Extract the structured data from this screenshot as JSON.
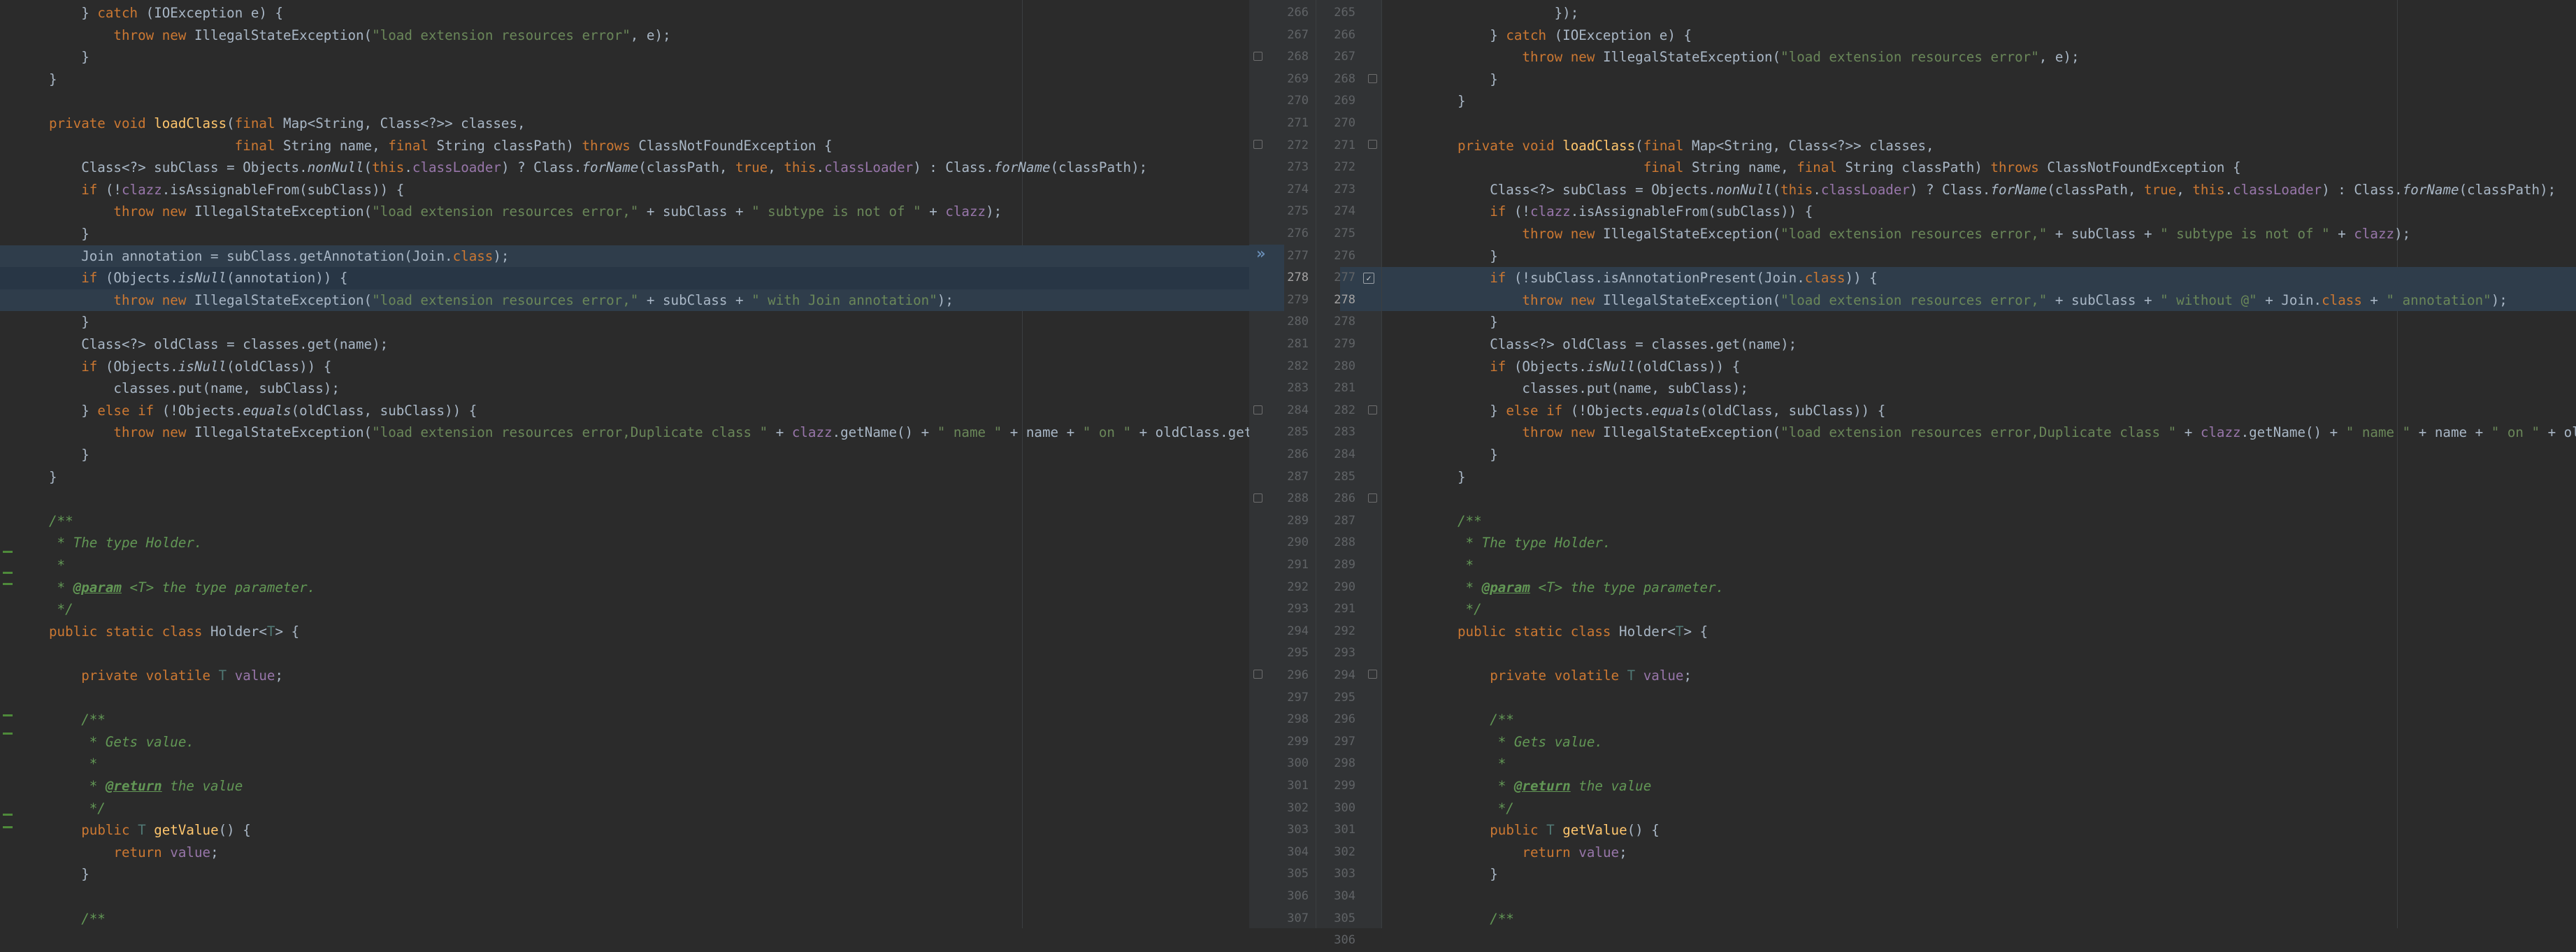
{
  "left": {
    "lines": [
      [
        [
          "    ",
          "n"
        ],
        [
          "} ",
          "n"
        ],
        [
          "catch ",
          "k"
        ],
        [
          "(IOException e) {",
          "n"
        ]
      ],
      [
        [
          "        ",
          "n"
        ],
        [
          "throw new ",
          "k"
        ],
        [
          "IllegalStateException(",
          "n"
        ],
        [
          "\"load extension resources error\"",
          "s"
        ],
        [
          ", e);",
          "n"
        ]
      ],
      [
        [
          "    }",
          "n"
        ]
      ],
      [
        [
          "}",
          "n"
        ]
      ],
      [
        [
          "",
          "n"
        ]
      ],
      [
        [
          "private void ",
          "k"
        ],
        [
          "loadClass",
          "f"
        ],
        [
          "(",
          "n"
        ],
        [
          "final ",
          "k"
        ],
        [
          "Map<String, Class<?>> classes,",
          "n"
        ]
      ],
      [
        [
          "                       ",
          "n"
        ],
        [
          "final ",
          "k"
        ],
        [
          "String name, ",
          "n"
        ],
        [
          "final ",
          "k"
        ],
        [
          "String classPath) ",
          "n"
        ],
        [
          "throws ",
          "k"
        ],
        [
          "ClassNotFoundException {",
          "n"
        ]
      ],
      [
        [
          "    Class<?> subClass = Objects.",
          "n"
        ],
        [
          "nonNull",
          "i"
        ],
        [
          "(",
          "n"
        ],
        [
          "this",
          "k"
        ],
        [
          ".",
          "n"
        ],
        [
          "classLoader",
          "p"
        ],
        [
          ") ? Class.",
          "n"
        ],
        [
          "forName",
          "i"
        ],
        [
          "(classPath, ",
          "n"
        ],
        [
          "true",
          "k"
        ],
        [
          ", ",
          "n"
        ],
        [
          "this",
          "k"
        ],
        [
          ".",
          "n"
        ],
        [
          "classLoader",
          "p"
        ],
        [
          ") : Class.",
          "n"
        ],
        [
          "forName",
          "i"
        ],
        [
          "(classPath);",
          "n"
        ]
      ],
      [
        [
          "    ",
          "n"
        ],
        [
          "if ",
          "k"
        ],
        [
          "(!",
          "n"
        ],
        [
          "clazz",
          "p"
        ],
        [
          ".isAssignableFrom(subClass)) {",
          "n"
        ]
      ],
      [
        [
          "        ",
          "n"
        ],
        [
          "throw new ",
          "k"
        ],
        [
          "IllegalStateException(",
          "n"
        ],
        [
          "\"load extension resources error,\"",
          "s"
        ],
        [
          " + subClass + ",
          "n"
        ],
        [
          "\" subtype is not of \"",
          "s"
        ],
        [
          " + ",
          "n"
        ],
        [
          "clazz",
          "p"
        ],
        [
          ");",
          "n"
        ]
      ],
      [
        [
          "    }",
          "n"
        ]
      ],
      [
        [
          "    Join annotation = subClass.getAnnotation(Join.",
          "n"
        ],
        [
          "class",
          "k"
        ],
        [
          ");",
          "n"
        ]
      ],
      [
        [
          "    ",
          "n"
        ],
        [
          "if ",
          "k"
        ],
        [
          "(Objects.",
          "n"
        ],
        [
          "isNull",
          "i"
        ],
        [
          "(annotation)) {",
          "n"
        ]
      ],
      [
        [
          "        ",
          "n"
        ],
        [
          "throw new ",
          "k"
        ],
        [
          "IllegalStateException(",
          "n"
        ],
        [
          "\"load extension resources error,\"",
          "s"
        ],
        [
          " + subClass + ",
          "n"
        ],
        [
          "\" with Join annotation\"",
          "s"
        ],
        [
          ");",
          "n"
        ]
      ],
      [
        [
          "    }",
          "n"
        ]
      ],
      [
        [
          "    Class<?> oldClass = classes.get(name);",
          "n"
        ]
      ],
      [
        [
          "    ",
          "n"
        ],
        [
          "if ",
          "k"
        ],
        [
          "(Objects.",
          "n"
        ],
        [
          "isNull",
          "i"
        ],
        [
          "(oldClass)) {",
          "n"
        ]
      ],
      [
        [
          "        classes.put(name, subClass);",
          "n"
        ]
      ],
      [
        [
          "    } ",
          "n"
        ],
        [
          "else if ",
          "k"
        ],
        [
          "(!Objects.",
          "n"
        ],
        [
          "equals",
          "i"
        ],
        [
          "(oldClass, subClass)) {",
          "n"
        ]
      ],
      [
        [
          "        ",
          "n"
        ],
        [
          "throw new ",
          "k"
        ],
        [
          "IllegalStateException(",
          "n"
        ],
        [
          "\"load extension resources error,Duplicate class \"",
          "s"
        ],
        [
          " + ",
          "n"
        ],
        [
          "clazz",
          "p"
        ],
        [
          ".getName() + ",
          "n"
        ],
        [
          "\" name \"",
          "s"
        ],
        [
          " + name + ",
          "n"
        ],
        [
          "\" on \"",
          "s"
        ],
        [
          " + oldClass.getName() + ",
          "n"
        ]
      ],
      [
        [
          "    }",
          "n"
        ]
      ],
      [
        [
          "}",
          "n"
        ]
      ],
      [
        [
          "",
          "n"
        ]
      ],
      [
        [
          "/**",
          "c"
        ]
      ],
      [
        [
          " * The type Holder.",
          "c"
        ]
      ],
      [
        [
          " *",
          "c"
        ]
      ],
      [
        [
          " * ",
          "c"
        ],
        [
          "@param",
          "d"
        ],
        [
          " <T> the type parameter.",
          "c"
        ]
      ],
      [
        [
          " */",
          "c"
        ]
      ],
      [
        [
          "public static class ",
          "k"
        ],
        [
          "Holder<",
          "n"
        ],
        [
          "T",
          "t"
        ],
        [
          "> {",
          "n"
        ]
      ],
      [
        [
          "",
          "n"
        ]
      ],
      [
        [
          "    ",
          "n"
        ],
        [
          "private volatile ",
          "k"
        ],
        [
          "T ",
          "t"
        ],
        [
          "value",
          "p"
        ],
        [
          ";",
          "n"
        ]
      ],
      [
        [
          "",
          "n"
        ]
      ],
      [
        [
          "    /**",
          "c"
        ]
      ],
      [
        [
          "     * Gets value.",
          "c"
        ]
      ],
      [
        [
          "     *",
          "c"
        ]
      ],
      [
        [
          "     * ",
          "c"
        ],
        [
          "@return",
          "d"
        ],
        [
          " the value",
          "c"
        ]
      ],
      [
        [
          "     */",
          "c"
        ]
      ],
      [
        [
          "    ",
          "n"
        ],
        [
          "public ",
          "k"
        ],
        [
          "T ",
          "t"
        ],
        [
          "getValue",
          "f"
        ],
        [
          "() {",
          "n"
        ]
      ],
      [
        [
          "        ",
          "n"
        ],
        [
          "return ",
          "k"
        ],
        [
          "value",
          "p"
        ],
        [
          ";",
          "n"
        ]
      ],
      [
        [
          "    }",
          "n"
        ]
      ],
      [
        [
          "",
          "n"
        ]
      ],
      [
        [
          "    /**",
          "c"
        ]
      ]
    ]
  },
  "right": {
    "lines": [
      [
        [
          "            });",
          "n"
        ]
      ],
      [
        [
          "    } ",
          "n"
        ],
        [
          "catch ",
          "k"
        ],
        [
          "(IOException e) {",
          "n"
        ]
      ],
      [
        [
          "        ",
          "n"
        ],
        [
          "throw new ",
          "k"
        ],
        [
          "IllegalStateException(",
          "n"
        ],
        [
          "\"load extension resources error\"",
          "s"
        ],
        [
          ", e);",
          "n"
        ]
      ],
      [
        [
          "    }",
          "n"
        ]
      ],
      [
        [
          "}",
          "n"
        ]
      ],
      [
        [
          "",
          "n"
        ]
      ],
      [
        [
          "private void ",
          "k"
        ],
        [
          "loadClass",
          "f"
        ],
        [
          "(",
          "n"
        ],
        [
          "final ",
          "k"
        ],
        [
          "Map<String, Class<?>> classes,",
          "n"
        ]
      ],
      [
        [
          "                       ",
          "n"
        ],
        [
          "final ",
          "k"
        ],
        [
          "String name, ",
          "n"
        ],
        [
          "final ",
          "k"
        ],
        [
          "String classPath) ",
          "n"
        ],
        [
          "throws ",
          "k"
        ],
        [
          "ClassNotFoundException {",
          "n"
        ]
      ],
      [
        [
          "    Class<?> subClass = Objects.",
          "n"
        ],
        [
          "nonNull",
          "i"
        ],
        [
          "(",
          "n"
        ],
        [
          "this",
          "k"
        ],
        [
          ".",
          "n"
        ],
        [
          "classLoader",
          "p"
        ],
        [
          ") ? Class.",
          "n"
        ],
        [
          "forName",
          "i"
        ],
        [
          "(classPath, ",
          "n"
        ],
        [
          "true",
          "k"
        ],
        [
          ", ",
          "n"
        ],
        [
          "this",
          "k"
        ],
        [
          ".",
          "n"
        ],
        [
          "classLoader",
          "p"
        ],
        [
          ") : Class.",
          "n"
        ],
        [
          "forName",
          "i"
        ],
        [
          "(classPath);",
          "n"
        ]
      ],
      [
        [
          "    ",
          "n"
        ],
        [
          "if ",
          "k"
        ],
        [
          "(!",
          "n"
        ],
        [
          "clazz",
          "p"
        ],
        [
          ".isAssignableFrom(subClass)) {",
          "n"
        ]
      ],
      [
        [
          "        ",
          "n"
        ],
        [
          "throw new ",
          "k"
        ],
        [
          "IllegalStateException(",
          "n"
        ],
        [
          "\"load extension resources error,\"",
          "s"
        ],
        [
          " + subClass + ",
          "n"
        ],
        [
          "\" subtype is not of \"",
          "s"
        ],
        [
          " + ",
          "n"
        ],
        [
          "clazz",
          "p"
        ],
        [
          ");",
          "n"
        ]
      ],
      [
        [
          "    }",
          "n"
        ]
      ],
      [
        [
          "    ",
          "n"
        ],
        [
          "if ",
          "k"
        ],
        [
          "(!subClass.isAnnotationPresent(Join.",
          "n"
        ],
        [
          "class",
          "k"
        ],
        [
          ")) {",
          "n"
        ]
      ],
      [
        [
          "        ",
          "n"
        ],
        [
          "throw new ",
          "k"
        ],
        [
          "IllegalStateException(",
          "n"
        ],
        [
          "\"load extension resources error,\"",
          "s"
        ],
        [
          " + subClass + ",
          "n"
        ],
        [
          "\" without @\"",
          "s"
        ],
        [
          " + Join.",
          "n"
        ],
        [
          "class",
          "k"
        ],
        [
          " + ",
          "n"
        ],
        [
          "\" annotation\"",
          "s"
        ],
        [
          ");",
          "n"
        ]
      ],
      [
        [
          "    }",
          "n"
        ]
      ],
      [
        [
          "    Class<?> oldClass = classes.get(name);",
          "n"
        ]
      ],
      [
        [
          "    ",
          "n"
        ],
        [
          "if ",
          "k"
        ],
        [
          "(Objects.",
          "n"
        ],
        [
          "isNull",
          "i"
        ],
        [
          "(oldClass)) {",
          "n"
        ]
      ],
      [
        [
          "        classes.put(name, subClass);",
          "n"
        ]
      ],
      [
        [
          "    } ",
          "n"
        ],
        [
          "else if ",
          "k"
        ],
        [
          "(!Objects.",
          "n"
        ],
        [
          "equals",
          "i"
        ],
        [
          "(oldClass, subClass)) {",
          "n"
        ]
      ],
      [
        [
          "        ",
          "n"
        ],
        [
          "throw new ",
          "k"
        ],
        [
          "IllegalStateException(",
          "n"
        ],
        [
          "\"load extension resources error,Duplicate class \"",
          "s"
        ],
        [
          " + ",
          "n"
        ],
        [
          "clazz",
          "p"
        ],
        [
          ".getName() + ",
          "n"
        ],
        [
          "\" name \"",
          "s"
        ],
        [
          " + name + ",
          "n"
        ],
        [
          "\" on \"",
          "s"
        ],
        [
          " + oldClass.getName() + ",
          "n"
        ]
      ],
      [
        [
          "    }",
          "n"
        ]
      ],
      [
        [
          "}",
          "n"
        ]
      ],
      [
        [
          "",
          "n"
        ]
      ],
      [
        [
          "/**",
          "c"
        ]
      ],
      [
        [
          " * The type Holder.",
          "c"
        ]
      ],
      [
        [
          " *",
          "c"
        ]
      ],
      [
        [
          " * ",
          "c"
        ],
        [
          "@param",
          "d"
        ],
        [
          " <T> the type parameter.",
          "c"
        ]
      ],
      [
        [
          " */",
          "c"
        ]
      ],
      [
        [
          "public static class ",
          "k"
        ],
        [
          "Holder<",
          "n"
        ],
        [
          "T",
          "t"
        ],
        [
          "> {",
          "n"
        ]
      ],
      [
        [
          "",
          "n"
        ]
      ],
      [
        [
          "    ",
          "n"
        ],
        [
          "private volatile ",
          "k"
        ],
        [
          "T ",
          "t"
        ],
        [
          "value",
          "p"
        ],
        [
          ";",
          "n"
        ]
      ],
      [
        [
          "",
          "n"
        ]
      ],
      [
        [
          "    /**",
          "c"
        ]
      ],
      [
        [
          "     * Gets value.",
          "c"
        ]
      ],
      [
        [
          "     *",
          "c"
        ]
      ],
      [
        [
          "     * ",
          "c"
        ],
        [
          "@return",
          "d"
        ],
        [
          " the value",
          "c"
        ]
      ],
      [
        [
          "     */",
          "c"
        ]
      ],
      [
        [
          "    ",
          "n"
        ],
        [
          "public ",
          "k"
        ],
        [
          "T ",
          "t"
        ],
        [
          "getValue",
          "f"
        ],
        [
          "() {",
          "n"
        ]
      ],
      [
        [
          "        ",
          "n"
        ],
        [
          "return ",
          "k"
        ],
        [
          "value",
          "p"
        ],
        [
          ";",
          "n"
        ]
      ],
      [
        [
          "    }",
          "n"
        ]
      ],
      [
        [
          "",
          "n"
        ]
      ],
      [
        [
          "    /**",
          "c"
        ]
      ]
    ]
  },
  "gutter": {
    "left_numbers": [
      "266",
      "267",
      "268",
      "269",
      "270",
      "271",
      "272",
      "273",
      "274",
      "275",
      "276",
      "277",
      "278",
      "279",
      "280",
      "281",
      "282",
      "283",
      "284",
      "285",
      "286",
      "287",
      "288",
      "289",
      "290",
      "291",
      "292",
      "293",
      "294",
      "295",
      "296",
      "297",
      "298",
      "299",
      "300",
      "301",
      "302",
      "303",
      "304",
      "305",
      "306",
      "307"
    ],
    "right_numbers": [
      "265",
      "266",
      "267",
      "268",
      "269",
      "270",
      "271",
      "272",
      "273",
      "274",
      "275",
      "276",
      "277",
      "278",
      "278",
      "279",
      "280",
      "281",
      "282",
      "283",
      "284",
      "285",
      "286",
      "287",
      "288",
      "289",
      "290",
      "291",
      "292",
      "293",
      "294",
      "295",
      "296",
      "297",
      "298",
      "299",
      "300",
      "301",
      "302",
      "303",
      "304",
      "305",
      "306"
    ],
    "current_line_label": "278",
    "apply_arrow": "»",
    "check_mark": "✓"
  }
}
